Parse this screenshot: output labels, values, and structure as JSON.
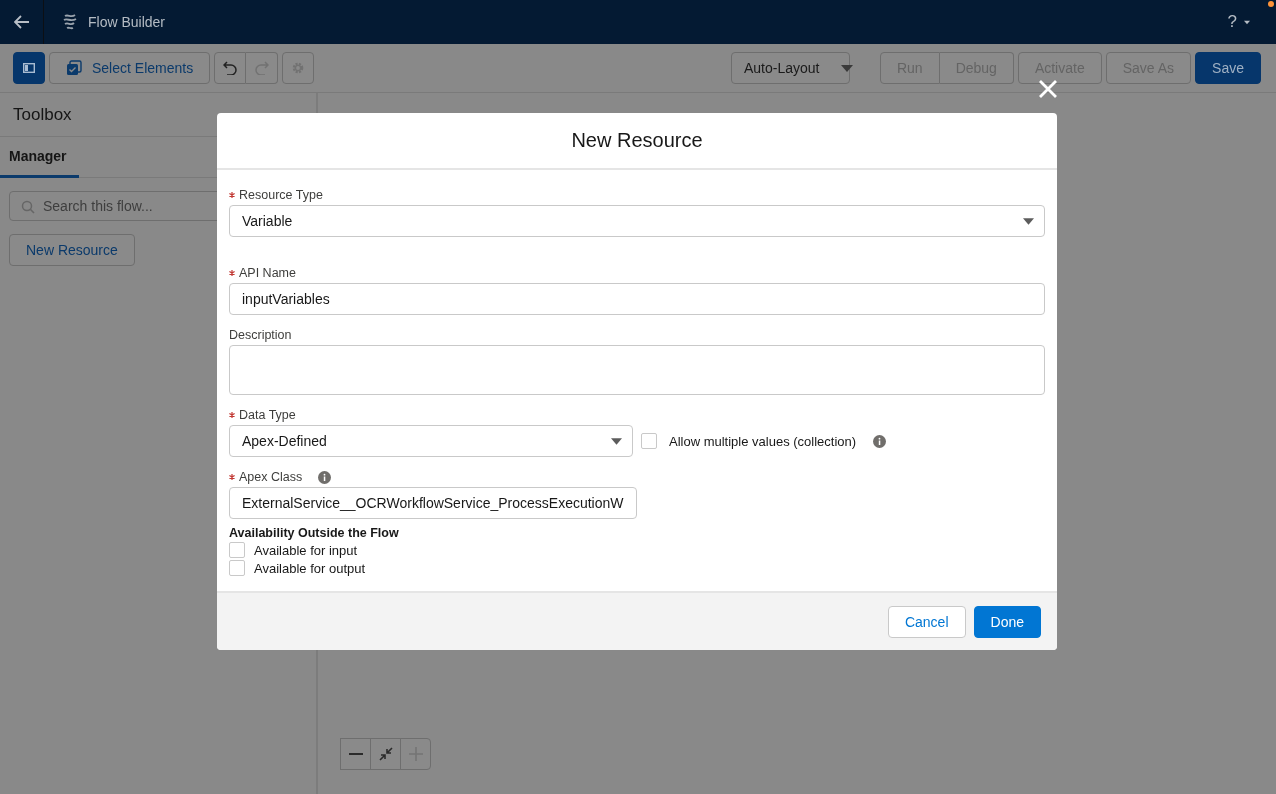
{
  "header": {
    "title": "Flow Builder",
    "help": "?"
  },
  "toolbar": {
    "left": [
      {
        "kind": "panel",
        "selected": true
      },
      {
        "kind": "select-elements",
        "label": "Select Elements"
      },
      {
        "kind": "undo",
        "disabled": false
      },
      {
        "kind": "redo",
        "disabled": true
      },
      {
        "kind": "gear",
        "disabled": true
      }
    ],
    "layout_menu": "Auto-Layout",
    "actions": [
      {
        "label": "Run",
        "disabled": true,
        "primary": false
      },
      {
        "label": "Debug",
        "disabled": true,
        "primary": false
      },
      {
        "label": "Activate",
        "disabled": true,
        "primary": false
      },
      {
        "label": "Save As",
        "disabled": true,
        "primary": false
      },
      {
        "label": "Save",
        "disabled": false,
        "primary": true
      }
    ]
  },
  "sidebar": {
    "title": "Toolbox",
    "tabs": [
      {
        "label": "Manager",
        "selected": true
      }
    ],
    "search": {
      "placeholder": "Search this flow..."
    },
    "button": "New Resource"
  },
  "zoom": [
    {
      "kind": "zoom-out",
      "disabled": false
    },
    {
      "kind": "fit",
      "disabled": false
    },
    {
      "kind": "zoom-in",
      "disabled": true
    }
  ],
  "modal": {
    "title": "New Resource",
    "fields": [
      {
        "kind": "select",
        "label": "Resource Type",
        "required": true,
        "value": "Variable"
      },
      {
        "kind": "text",
        "label": "API Name",
        "required": true,
        "value": "inputVariables"
      },
      {
        "kind": "textarea",
        "label": "Description",
        "required": false
      },
      {
        "kind": "select",
        "label": "Data Type",
        "required": true,
        "value": "Apex-Defined",
        "checkbox": {
          "label": "Allow multiple values (collection)",
          "checked": false,
          "info": true
        }
      },
      {
        "kind": "lookup",
        "label": "Apex Class",
        "required": true,
        "info": true,
        "value": "ExternalService__OCRWorkflowService_ProcessExecutionW"
      }
    ],
    "availability": {
      "heading": "Availability Outside the Flow",
      "options": [
        {
          "label": "Available for input",
          "checked": false
        },
        {
          "label": "Available for output",
          "checked": false
        }
      ]
    },
    "buttons": [
      {
        "label": "Cancel",
        "primary": false
      },
      {
        "label": "Done",
        "primary": true
      }
    ]
  }
}
